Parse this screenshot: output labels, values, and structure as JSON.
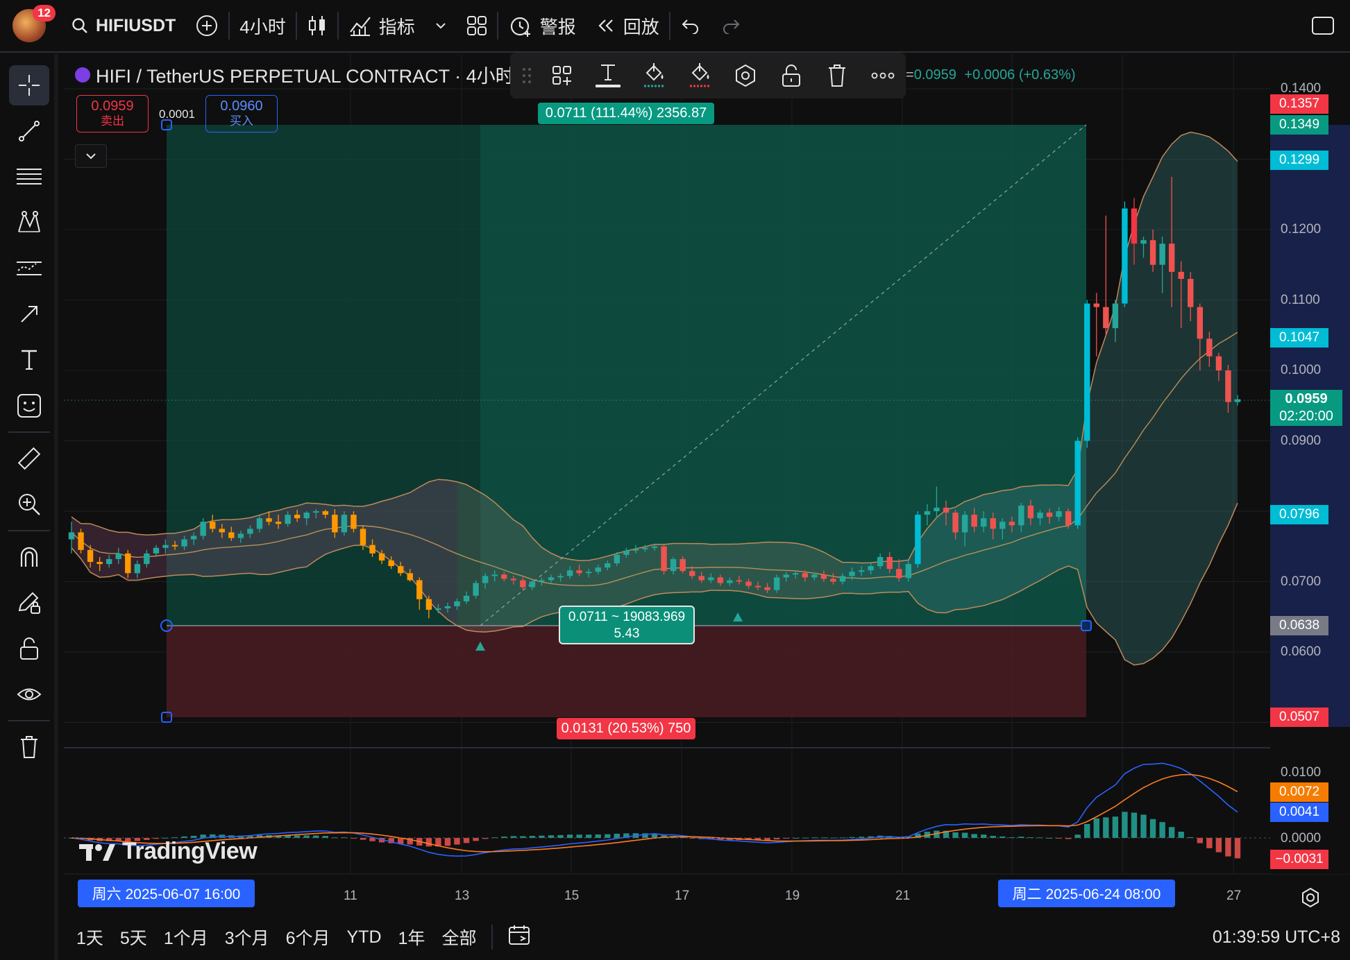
{
  "topbar": {
    "notifications": "12",
    "symbol": "HIFIUSDT",
    "interval": "4小时",
    "indicators_label": "指标",
    "alerts_label": "警报",
    "replay_label": "回放"
  },
  "legend": {
    "title": "HIFI / TetherUS PERPETUAL CONTRACT · 4小时",
    "change_prefix": "=",
    "last": "0.0959",
    "change": "+0.0006 (+0.63%)"
  },
  "trade": {
    "sell_price": "0.0959",
    "sell_label": "卖出",
    "spread": "0.0001",
    "buy_price": "0.0960",
    "buy_label": "买入"
  },
  "position_tool": {
    "target_label": "0.0711 (111.44%) 2356.87",
    "center_line1": "0.0711 ~ 19083.969",
    "center_line2": "5.43",
    "stop_label": "0.0131 (20.53%) 750"
  },
  "price_axis": {
    "ticks": [
      "0.1400",
      "0.1200",
      "0.1100",
      "0.1000",
      "0.0900",
      "0.0700",
      "0.0600"
    ],
    "tags": {
      "t1357": "0.1357",
      "t1349": "0.1349",
      "t1299": "0.1299",
      "t1047": "0.1047",
      "last": "0.0959",
      "countdown": "02:20:00",
      "t0796": "0.0796",
      "t0638": "0.0638",
      "t0507": "0.0507"
    }
  },
  "macd_axis": {
    "ticks": [
      "0.0100",
      "0.0000"
    ],
    "tags": {
      "signal": "0.0072",
      "macd": "0.0041",
      "hist": "−0.0031"
    }
  },
  "time_axis": {
    "start_tag": "周六 2025-06-07   16:00",
    "ticks": [
      "11",
      "13",
      "15",
      "17",
      "19",
      "21",
      "27"
    ],
    "end_tag": "周二 2025-06-24   08:00"
  },
  "watermark": "TradingView",
  "bottombar": {
    "ranges": [
      "1天",
      "5天",
      "1个月",
      "3个月",
      "6个月",
      "YTD",
      "1年",
      "全部"
    ],
    "clock": "01:39:59 UTC+8"
  },
  "colors": {
    "up": "#26a69a",
    "down": "#ef5350",
    "cyan": "#00bcd4",
    "orange": "#ff9800",
    "red_tag": "#f23645",
    "green_tag": "#089981",
    "blue": "#2962ff"
  },
  "chart_data": {
    "type": "candlestick",
    "candles": [
      [
        0.076,
        0.0785,
        0.074,
        0.077
      ],
      [
        0.077,
        0.0775,
        0.074,
        0.0745
      ],
      [
        0.0745,
        0.0752,
        0.072,
        0.0728
      ],
      [
        0.0728,
        0.0735,
        0.0715,
        0.0725
      ],
      [
        0.0725,
        0.0738,
        0.072,
        0.0732
      ],
      [
        0.0732,
        0.0748,
        0.0725,
        0.074
      ],
      [
        0.074,
        0.0745,
        0.0705,
        0.0712
      ],
      [
        0.0712,
        0.073,
        0.0705,
        0.0725
      ],
      [
        0.0725,
        0.0745,
        0.072,
        0.074
      ],
      [
        0.074,
        0.0752,
        0.0735,
        0.0748
      ],
      [
        0.0748,
        0.076,
        0.074,
        0.0752
      ],
      [
        0.0752,
        0.0758,
        0.0745,
        0.075
      ],
      [
        0.075,
        0.0765,
        0.0745,
        0.076
      ],
      [
        0.076,
        0.077,
        0.0752,
        0.0765
      ],
      [
        0.0765,
        0.079,
        0.076,
        0.0785
      ],
      [
        0.0785,
        0.0795,
        0.077,
        0.0775
      ],
      [
        0.0775,
        0.0782,
        0.0762,
        0.077
      ],
      [
        0.077,
        0.0778,
        0.0758,
        0.0762
      ],
      [
        0.0762,
        0.0772,
        0.0755,
        0.0768
      ],
      [
        0.0768,
        0.078,
        0.0762,
        0.0775
      ],
      [
        0.0775,
        0.0795,
        0.077,
        0.079
      ],
      [
        0.079,
        0.08,
        0.078,
        0.0785
      ],
      [
        0.0785,
        0.0795,
        0.0775,
        0.0782
      ],
      [
        0.0782,
        0.08,
        0.0778,
        0.0795
      ],
      [
        0.0795,
        0.0802,
        0.0785,
        0.079
      ],
      [
        0.079,
        0.08,
        0.078,
        0.0798
      ],
      [
        0.0798,
        0.0803,
        0.079,
        0.08
      ],
      [
        0.08,
        0.0802,
        0.079,
        0.0795
      ],
      [
        0.0795,
        0.0803,
        0.0762,
        0.077
      ],
      [
        0.077,
        0.08,
        0.0765,
        0.0795
      ],
      [
        0.0795,
        0.08,
        0.077,
        0.0775
      ],
      [
        0.0775,
        0.078,
        0.0745,
        0.0752
      ],
      [
        0.0752,
        0.076,
        0.0735,
        0.074
      ],
      [
        0.074,
        0.0745,
        0.0725,
        0.073
      ],
      [
        0.073,
        0.0736,
        0.0718,
        0.0722
      ],
      [
        0.0722,
        0.0728,
        0.0708,
        0.0712
      ],
      [
        0.0712,
        0.0718,
        0.07,
        0.0702
      ],
      [
        0.0702,
        0.0706,
        0.066,
        0.0675
      ],
      [
        0.0675,
        0.068,
        0.0648,
        0.066
      ],
      [
        0.066,
        0.0668,
        0.0655,
        0.0662
      ],
      [
        0.0662,
        0.067,
        0.0656,
        0.0665
      ],
      [
        0.0665,
        0.0676,
        0.066,
        0.0672
      ],
      [
        0.0672,
        0.0686,
        0.0668,
        0.068
      ],
      [
        0.068,
        0.0702,
        0.0676,
        0.0698
      ],
      [
        0.0698,
        0.0712,
        0.069,
        0.0708
      ],
      [
        0.0708,
        0.0716,
        0.07,
        0.071
      ],
      [
        0.071,
        0.0714,
        0.07,
        0.0704
      ],
      [
        0.0704,
        0.0708,
        0.0696,
        0.0702
      ],
      [
        0.0702,
        0.0706,
        0.0688,
        0.0692
      ],
      [
        0.0692,
        0.0702,
        0.0688,
        0.07
      ],
      [
        0.07,
        0.0706,
        0.0694,
        0.0702
      ],
      [
        0.0702,
        0.071,
        0.0698,
        0.0706
      ],
      [
        0.0706,
        0.0712,
        0.07,
        0.0708
      ],
      [
        0.0708,
        0.0722,
        0.0704,
        0.0716
      ],
      [
        0.0716,
        0.0724,
        0.0708,
        0.0712
      ],
      [
        0.0712,
        0.0718,
        0.0706,
        0.0714
      ],
      [
        0.0714,
        0.0724,
        0.071,
        0.072
      ],
      [
        0.072,
        0.073,
        0.0716,
        0.0726
      ],
      [
        0.0726,
        0.0742,
        0.0722,
        0.0738
      ],
      [
        0.0738,
        0.0748,
        0.0734,
        0.0744
      ],
      [
        0.0744,
        0.0752,
        0.074,
        0.0746
      ],
      [
        0.0746,
        0.0752,
        0.0742,
        0.0748
      ],
      [
        0.0748,
        0.0752,
        0.0744,
        0.075
      ],
      [
        0.075,
        0.0752,
        0.071,
        0.0715
      ],
      [
        0.0715,
        0.0735,
        0.071,
        0.0732
      ],
      [
        0.0732,
        0.0736,
        0.0712,
        0.0715
      ],
      [
        0.0715,
        0.0722,
        0.0704,
        0.0708
      ],
      [
        0.0708,
        0.0714,
        0.0698,
        0.0702
      ],
      [
        0.0702,
        0.0712,
        0.0698,
        0.0706
      ],
      [
        0.0706,
        0.071,
        0.0694,
        0.0698
      ],
      [
        0.0698,
        0.0706,
        0.0694,
        0.0702
      ],
      [
        0.0702,
        0.0708,
        0.0696,
        0.07
      ],
      [
        0.07,
        0.0704,
        0.069,
        0.0694
      ],
      [
        0.0694,
        0.07,
        0.0688,
        0.0692
      ],
      [
        0.0692,
        0.0698,
        0.0684,
        0.0688
      ],
      [
        0.0688,
        0.071,
        0.0684,
        0.0706
      ],
      [
        0.0706,
        0.0714,
        0.07,
        0.071
      ],
      [
        0.071,
        0.0716,
        0.0704,
        0.0712
      ],
      [
        0.0712,
        0.0716,
        0.07,
        0.0706
      ],
      [
        0.0706,
        0.0712,
        0.0702,
        0.071
      ],
      [
        0.071,
        0.0716,
        0.07,
        0.0704
      ],
      [
        0.0704,
        0.0712,
        0.0696,
        0.07
      ],
      [
        0.07,
        0.0712,
        0.0696,
        0.0708
      ],
      [
        0.0708,
        0.072,
        0.0702,
        0.0714
      ],
      [
        0.0714,
        0.0722,
        0.0708,
        0.0716
      ],
      [
        0.0716,
        0.0726,
        0.071,
        0.0722
      ],
      [
        0.0722,
        0.074,
        0.0718,
        0.0735
      ],
      [
        0.0735,
        0.0742,
        0.0712,
        0.0718
      ],
      [
        0.0718,
        0.0732,
        0.07,
        0.0705
      ],
      [
        0.0705,
        0.073,
        0.07,
        0.0725
      ],
      [
        0.0725,
        0.08,
        0.072,
        0.0795
      ],
      [
        0.0795,
        0.081,
        0.078,
        0.08
      ],
      [
        0.08,
        0.0835,
        0.079,
        0.0805
      ],
      [
        0.0805,
        0.0815,
        0.078,
        0.0798
      ],
      [
        0.0798,
        0.0802,
        0.076,
        0.077
      ],
      [
        0.077,
        0.08,
        0.075,
        0.0795
      ],
      [
        0.0795,
        0.0805,
        0.077,
        0.0778
      ],
      [
        0.0778,
        0.08,
        0.077,
        0.079
      ],
      [
        0.079,
        0.0798,
        0.076,
        0.0775
      ],
      [
        0.0775,
        0.079,
        0.076,
        0.0785
      ],
      [
        0.0785,
        0.0792,
        0.077,
        0.078
      ],
      [
        0.078,
        0.0812,
        0.077,
        0.0808
      ],
      [
        0.0808,
        0.0816,
        0.078,
        0.079
      ],
      [
        0.079,
        0.0802,
        0.078,
        0.0798
      ],
      [
        0.0798,
        0.0804,
        0.0782,
        0.0792
      ],
      [
        0.0792,
        0.0806,
        0.0786,
        0.08
      ],
      [
        0.08,
        0.0804,
        0.0775,
        0.078
      ],
      [
        0.078,
        0.0905,
        0.0775,
        0.09
      ],
      [
        0.09,
        0.11,
        0.089,
        0.1095
      ],
      [
        0.1095,
        0.111,
        0.102,
        0.109
      ],
      [
        0.109,
        0.122,
        0.105,
        0.106
      ],
      [
        0.106,
        0.11,
        0.104,
        0.1095
      ],
      [
        0.1095,
        0.124,
        0.109,
        0.123
      ],
      [
        0.123,
        0.1245,
        0.115,
        0.118
      ],
      [
        0.118,
        0.119,
        0.116,
        0.1185
      ],
      [
        0.1185,
        0.12,
        0.114,
        0.115
      ],
      [
        0.115,
        0.119,
        0.111,
        0.118
      ],
      [
        0.118,
        0.1275,
        0.109,
        0.114
      ],
      [
        0.114,
        0.1155,
        0.106,
        0.113
      ],
      [
        0.113,
        0.114,
        0.107,
        0.109
      ],
      [
        0.109,
        0.1095,
        0.1,
        0.1045
      ],
      [
        0.1045,
        0.1055,
        0.1005,
        0.102
      ],
      [
        0.102,
        0.1025,
        0.0985,
        0.1
      ],
      [
        0.1,
        0.1008,
        0.094,
        0.0955
      ],
      [
        0.0955,
        0.0965,
        0.095,
        0.0959
      ]
    ],
    "position": {
      "entry": 0.0638,
      "target": 0.1349,
      "stop": 0.0507
    },
    "price_range": [
      0.046,
      0.142
    ]
  }
}
